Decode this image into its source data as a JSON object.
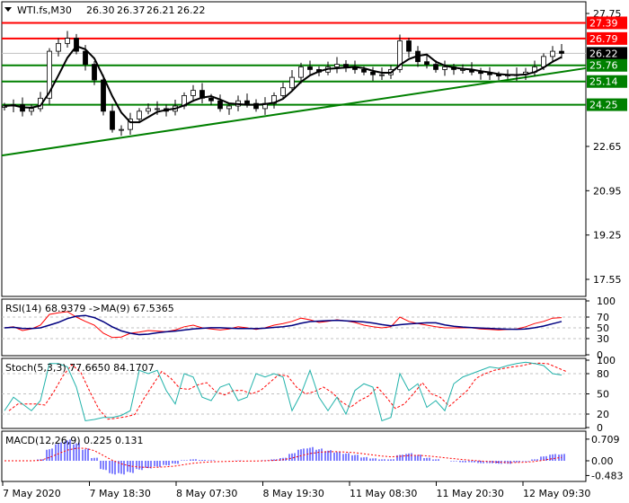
{
  "header": {
    "symbol": "WTI.fs,M30",
    "open": "26.30",
    "high": "26.37",
    "low": "26.21",
    "close": "26.22"
  },
  "colors": {
    "resistance": "#ff0000",
    "support": "#008000",
    "current": "#000000",
    "candle": "#000000",
    "ma": "#000000",
    "rsi": "#ff0000",
    "rsi_ma": "#000080",
    "stoch_k": "#20b2aa",
    "stoch_d": "#ff0000",
    "macd_hist": "#0000ff",
    "macd_signal": "#ff0000"
  },
  "chart_data": [
    {
      "type": "candlestick",
      "title": "WTI.fs,M30",
      "ylim": [
        17.55,
        27.75
      ],
      "yticks": [
        "27.75",
        "22.65",
        "20.95",
        "19.25",
        "17.55"
      ],
      "xticks": [
        "7 May 2020",
        "7 May 18:30",
        "8 May 07:30",
        "8 May 19:30",
        "11 May 08:30",
        "11 May 20:30",
        "12 May 09:30"
      ],
      "closes": [
        24.2,
        24.25,
        24.0,
        24.1,
        24.5,
        26.3,
        26.6,
        26.8,
        26.3,
        25.8,
        25.2,
        24.0,
        23.3,
        23.3,
        23.7,
        24.0,
        24.1,
        24.1,
        24.0,
        24.2,
        24.6,
        24.8,
        24.5,
        24.4,
        24.1,
        24.2,
        24.4,
        24.3,
        24.1,
        24.3,
        24.6,
        24.9,
        25.3,
        25.7,
        25.6,
        25.5,
        25.7,
        25.8,
        25.7,
        25.6,
        25.5,
        25.4,
        25.4,
        25.6,
        26.7,
        26.3,
        25.9,
        25.8,
        25.6,
        25.7,
        25.6,
        25.6,
        25.5,
        25.45,
        25.4,
        25.35,
        25.4,
        25.4,
        25.5,
        25.7,
        26.1,
        26.3,
        26.22
      ],
      "levels": [
        {
          "label": "27.39",
          "value": 27.39,
          "kind": "resistance"
        },
        {
          "label": "26.79",
          "value": 26.79,
          "kind": "resistance"
        },
        {
          "label": "26.22",
          "value": 26.22,
          "kind": "current"
        },
        {
          "label": "25.76",
          "value": 25.76,
          "kind": "support"
        },
        {
          "label": "25.14",
          "value": 25.14,
          "kind": "support"
        },
        {
          "label": "24.25",
          "value": 24.25,
          "kind": "support"
        }
      ],
      "trendline": {
        "start": 22.3,
        "end": 25.65
      }
    },
    {
      "type": "line",
      "title": "RSI(14) 68.9379  ->MA(9) 67.5365",
      "ylim": [
        0,
        100
      ],
      "yticks": [
        "100",
        "70",
        "50",
        "30",
        "0"
      ],
      "levels": [
        70,
        50,
        30
      ],
      "values": [
        50,
        52,
        45,
        48,
        55,
        75,
        78,
        80,
        70,
        62,
        55,
        40,
        32,
        33,
        40,
        42,
        45,
        44,
        43,
        46,
        52,
        55,
        50,
        48,
        46,
        48,
        52,
        50,
        47,
        50,
        55,
        58,
        62,
        68,
        65,
        60,
        62,
        65,
        63,
        60,
        55,
        52,
        50,
        52,
        70,
        62,
        58,
        55,
        52,
        50,
        50,
        50,
        50,
        48,
        47,
        46,
        47,
        48,
        52,
        58,
        62,
        68,
        69
      ]
    },
    {
      "type": "line",
      "title": "Stoch(5,3,3) 77.6650 84.1707",
      "ylim": [
        0,
        100
      ],
      "yticks": [
        "100",
        "80",
        "50",
        "20",
        "0"
      ],
      "levels": [
        80,
        50,
        20
      ],
      "values": [
        25,
        45,
        35,
        25,
        40,
        95,
        95,
        90,
        60,
        10,
        12,
        15,
        15,
        18,
        25,
        85,
        80,
        85,
        55,
        35,
        80,
        75,
        45,
        40,
        60,
        65,
        40,
        45,
        80,
        75,
        80,
        75,
        25,
        50,
        85,
        45,
        25,
        45,
        20,
        55,
        65,
        60,
        10,
        15,
        80,
        55,
        65,
        30,
        40,
        25,
        65,
        75,
        80,
        85,
        90,
        88,
        92,
        95,
        97,
        95,
        92,
        80,
        78
      ]
    },
    {
      "type": "bar",
      "title": "MACD(12,26,9) 0.225 0.131",
      "ylim": [
        -0.483,
        0.709
      ],
      "yticks": [
        "0.709",
        "0.00",
        "-0.483"
      ],
      "values": [
        0,
        0,
        0,
        0,
        0.05,
        0.4,
        0.6,
        0.7,
        0.6,
        0.4,
        0.1,
        -0.3,
        -0.45,
        -0.45,
        -0.4,
        -0.3,
        -0.25,
        -0.2,
        -0.15,
        -0.1,
        0.02,
        0.05,
        0.03,
        0.02,
        0,
        0,
        0.01,
        0,
        0,
        0.02,
        0.05,
        0.1,
        0.25,
        0.4,
        0.45,
        0.4,
        0.35,
        0.3,
        0.25,
        0.2,
        0.12,
        0.08,
        0.05,
        0.05,
        0.2,
        0.25,
        0.2,
        0.1,
        0.05,
        0,
        -0.02,
        -0.05,
        -0.05,
        -0.08,
        -0.08,
        -0.1,
        -0.1,
        -0.05,
        -0.02,
        0.05,
        0.15,
        0.22,
        0.225
      ]
    }
  ]
}
